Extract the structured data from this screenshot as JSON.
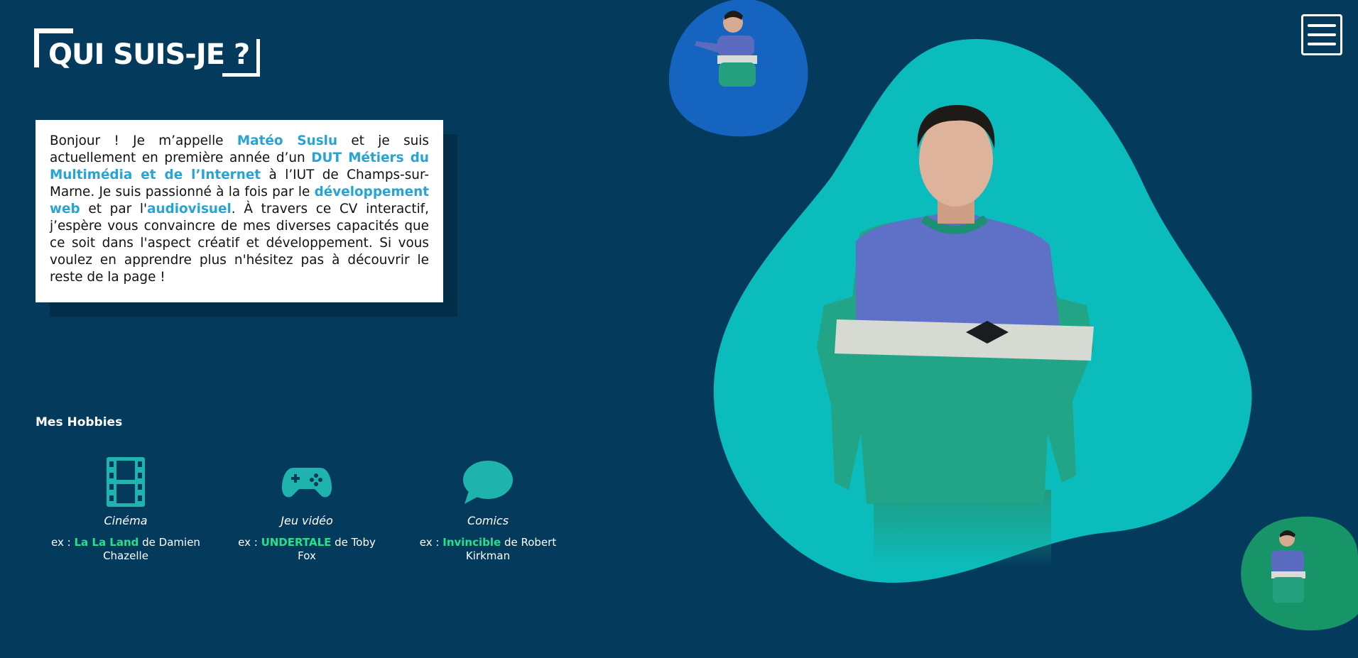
{
  "header": {
    "title": "QUI SUIS-JE ?"
  },
  "intro": {
    "segments": [
      {
        "text": "Bonjour ! Je m’appelle ",
        "highlight": false
      },
      {
        "text": "Matéo Suslu",
        "highlight": true
      },
      {
        "text": " et je suis actuellement en première année d’un ",
        "highlight": false
      },
      {
        "text": "DUT Métiers du Multimédia et de l’Internet",
        "highlight": true
      },
      {
        "text": " à l’IUT de Champs-sur-Marne. Je suis passionné à la fois par le ",
        "highlight": false
      },
      {
        "text": "développement web",
        "highlight": true
      },
      {
        "text": " et par l'",
        "highlight": false
      },
      {
        "text": "audiovisuel",
        "highlight": true
      },
      {
        "text": ". À travers ce CV interactif, j’espère vous convaincre de mes diverses capacités que ce soit dans l'aspect créatif et développement. Si vous voulez en apprendre plus n'hésitez pas à découvrir le reste de la page !",
        "highlight": false
      }
    ]
  },
  "hobbies": {
    "title": "Mes Hobbies",
    "items": [
      {
        "name": "Cinéma",
        "prefix": "ex : ",
        "work": "La La Land",
        "suffix": " de Damien Chazelle",
        "icon": "film-icon"
      },
      {
        "name": "Jeu vidéo",
        "prefix": "ex : ",
        "work": "UNDERTALE",
        "suffix": " de Toby Fox",
        "icon": "gamepad-icon"
      },
      {
        "name": "Comics",
        "prefix": "ex : ",
        "work": "Invincible",
        "suffix": " de Robert Kirkman",
        "icon": "speech-bubble-icon"
      }
    ]
  },
  "menu": {
    "icon": "hamburger-menu-icon"
  },
  "colors": {
    "background": "#043a5c",
    "highlight": "#26a4d6",
    "accent_green": "#27e08a",
    "icon_teal": "#1fb3ad",
    "blob_main": "#0bbcbc",
    "blob_top": "#1565c0",
    "blob_bottom_right": "#179468"
  }
}
